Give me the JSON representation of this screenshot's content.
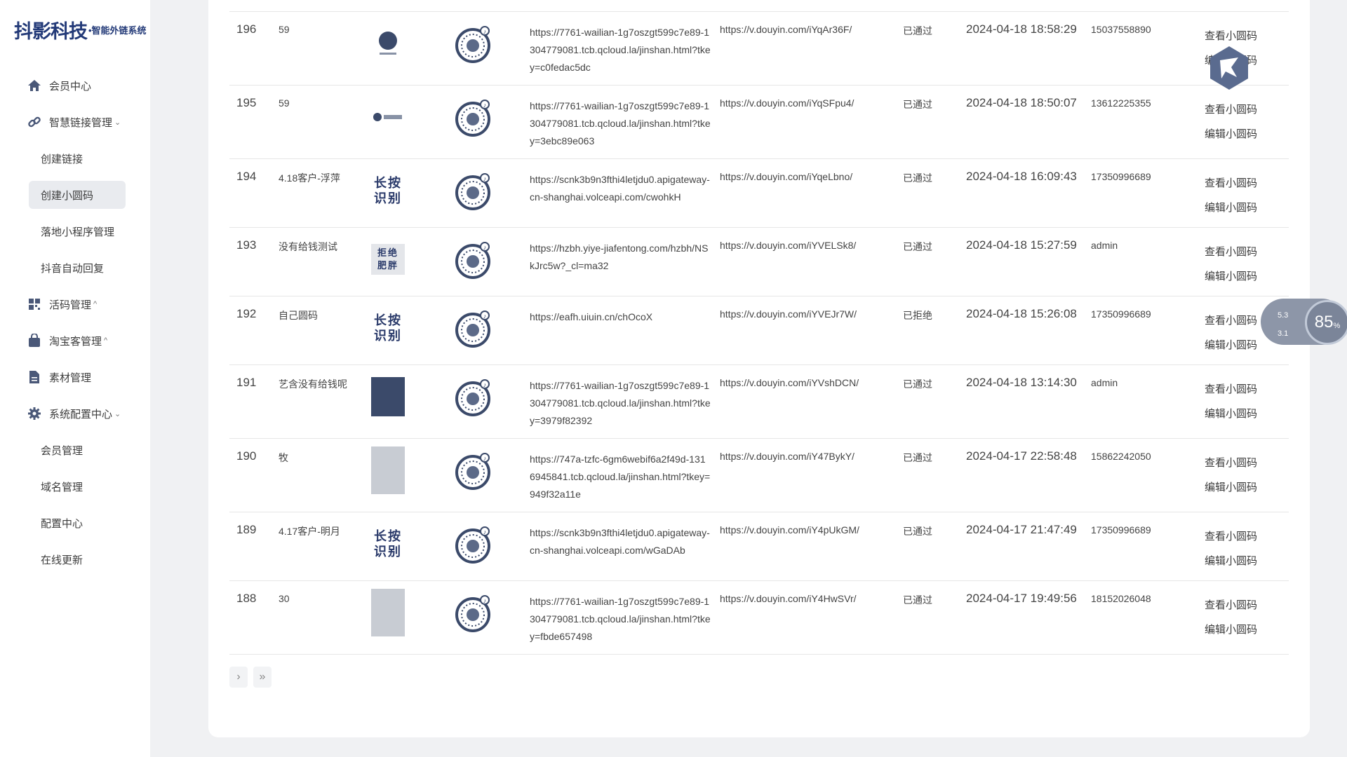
{
  "brand": {
    "name": "抖影科技",
    "subtitle": "•智能外链系统"
  },
  "sidebar": {
    "items": [
      {
        "label": "会员中心",
        "icon": "home-icon",
        "type": "top"
      },
      {
        "label": "智慧链接管理",
        "icon": "link-icon",
        "type": "top",
        "caret": "⌄"
      },
      {
        "label": "创建链接",
        "type": "sub"
      },
      {
        "label": "创建小圆码",
        "type": "sub",
        "active": true
      },
      {
        "label": "落地小程序管理",
        "type": "sub"
      },
      {
        "label": "抖音自动回复",
        "type": "sub"
      },
      {
        "label": "活码管理",
        "icon": "grid-icon",
        "type": "top",
        "caret": "^"
      },
      {
        "label": "淘宝客管理",
        "icon": "bag-icon",
        "type": "top",
        "caret": "^"
      },
      {
        "label": "素材管理",
        "icon": "file-icon",
        "type": "top"
      },
      {
        "label": "系统配置中心",
        "icon": "gear-icon",
        "type": "top",
        "caret": "⌄"
      },
      {
        "label": "会员管理",
        "type": "sub"
      },
      {
        "label": "域名管理",
        "type": "sub"
      },
      {
        "label": "配置中心",
        "type": "sub"
      },
      {
        "label": "在线更新",
        "type": "sub"
      }
    ]
  },
  "table": {
    "op_view": "查看小圆码",
    "op_edit": "编辑小圆码",
    "rows": [
      {
        "id": "196",
        "name": "59",
        "thumb": "badge",
        "url": "https://7761-wailian-1g7oszgt599c7e89-1304779081.tcb.qcloud.la/jinshan.html?tkey=c0fedac5dc",
        "douyin": "https://v.douyin.com/iYqAr36F/",
        "status": "已通过",
        "time": "2024-04-18 18:58:29",
        "user": "15037558890"
      },
      {
        "id": "195",
        "name": "59",
        "thumb": "logo",
        "url": "https://7761-wailian-1g7oszgt599c7e89-1304779081.tcb.qcloud.la/jinshan.html?tkey=3ebc89e063",
        "douyin": "https://v.douyin.com/iYqSFpu4/",
        "status": "已通过",
        "time": "2024-04-18 18:50:07",
        "user": "13612225355"
      },
      {
        "id": "194",
        "name": "4.18客户-浮萍",
        "thumb": "text",
        "thumb_text": "长按识别",
        "url": "https://scnk3b9n3fthi4letjdu0.apigateway-cn-shanghai.volceapi.com/cwohkH",
        "douyin": "https://v.douyin.com/iYqeLbno/",
        "status": "已通过",
        "time": "2024-04-18 16:09:43",
        "user": "17350996689"
      },
      {
        "id": "193",
        "name": "没有给钱测试",
        "thumb": "text-gray",
        "thumb_text": "拒绝肥胖",
        "url": "https://hzbh.yiye-jiafentong.com/hzbh/NSkJrc5w?_cl=ma32",
        "douyin": "https://v.douyin.com/iYVELSk8/",
        "status": "已通过",
        "time": "2024-04-18 15:27:59",
        "user": "admin"
      },
      {
        "id": "192",
        "name": "自己圆码",
        "thumb": "text",
        "thumb_text": "长按识别",
        "url": "https://eafh.uiuin.cn/chOcoX",
        "douyin": "https://v.douyin.com/iYVEJr7W/",
        "status": "已拒绝",
        "time": "2024-04-18 15:26:08",
        "user": "17350996689"
      },
      {
        "id": "191",
        "name": "艺含没有给钱呢",
        "thumb": "dark",
        "url": "https://7761-wailian-1g7oszgt599c7e89-1304779081.tcb.qcloud.la/jinshan.html?tkey=3979f82392",
        "douyin": "https://v.douyin.com/iYVshDCN/",
        "status": "已通过",
        "time": "2024-04-18 13:14:30",
        "user": "admin"
      },
      {
        "id": "190",
        "name": "牧",
        "thumb": "photo",
        "url": "https://747a-tzfc-6gm6webif6a2f49d-1316945841.tcb.qcloud.la/jinshan.html?tkey=949f32a11e",
        "douyin": "https://v.douyin.com/iY47BykY/",
        "status": "已通过",
        "time": "2024-04-17 22:58:48",
        "user": "15862242050"
      },
      {
        "id": "189",
        "name": "4.17客户-明月",
        "thumb": "text",
        "thumb_text": "长按识别",
        "url": "https://scnk3b9n3fthi4letjdu0.apigateway-cn-shanghai.volceapi.com/wGaDAb",
        "douyin": "https://v.douyin.com/iY4pUkGM/",
        "status": "已通过",
        "time": "2024-04-17 21:47:49",
        "user": "17350996689"
      },
      {
        "id": "188",
        "name": "30",
        "thumb": "photo",
        "url": "https://7761-wailian-1g7oszgt599c7e89-1304779081.tcb.qcloud.la/jinshan.html?tkey=fbde657498",
        "douyin": "https://v.douyin.com/iY4HwSVr/",
        "status": "已通过",
        "time": "2024-04-17 19:49:56",
        "user": "18152026048"
      }
    ]
  },
  "pager": {
    "next": "›",
    "last": "»"
  },
  "zoom_widget": {
    "up": "5.3",
    "down": "3.1",
    "percent": "85",
    "unit": "%"
  },
  "colors": {
    "brand": "#233a78",
    "sidebar_bg": "#ffffff",
    "page_bg": "#f0f1f3"
  }
}
